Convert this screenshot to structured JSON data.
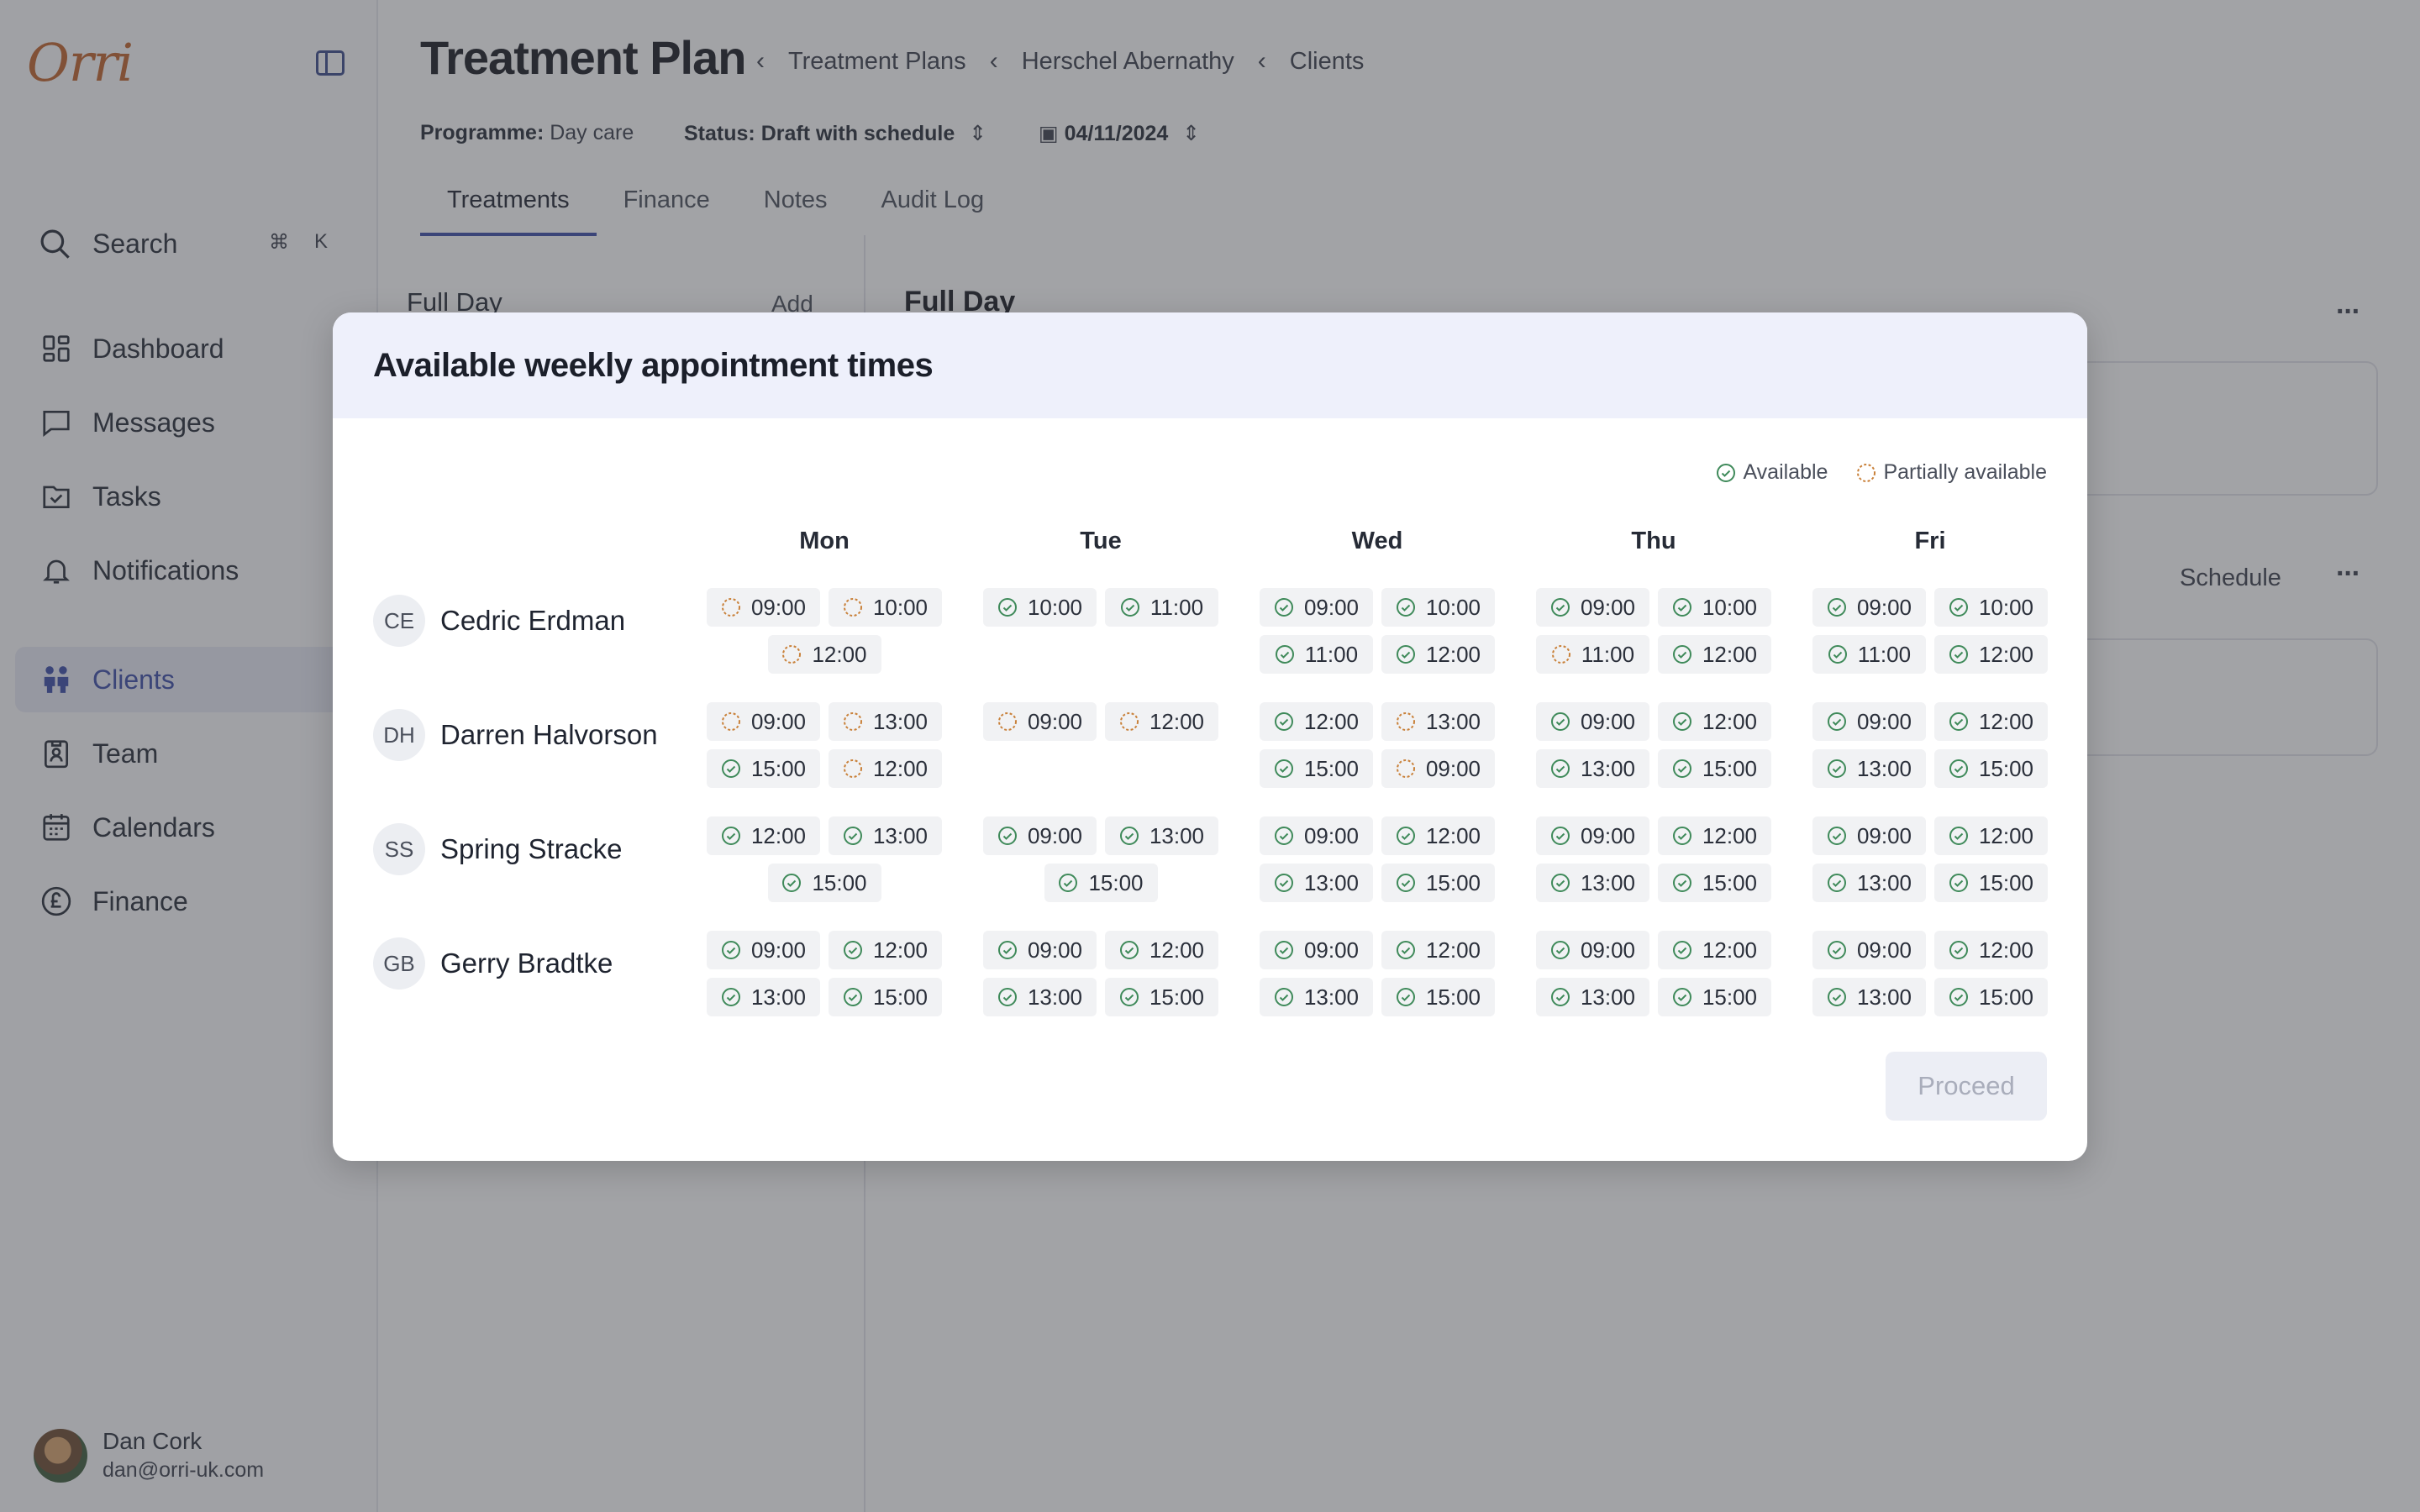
{
  "brand": {
    "logo_text": "Orri",
    "logo_color": "#c0622b",
    "accent": "#3a4ba8"
  },
  "sidebar": {
    "search_label": "Search",
    "search_shortcut_mod": "⌘",
    "search_shortcut_key": "K",
    "items": [
      {
        "label": "Dashboard",
        "icon": "dashboard-icon"
      },
      {
        "label": "Messages",
        "icon": "message-icon"
      },
      {
        "label": "Tasks",
        "icon": "tasks-icon"
      },
      {
        "label": "Notifications",
        "icon": "bell-icon"
      },
      {
        "label": "Clients",
        "icon": "clients-icon",
        "active": true
      },
      {
        "label": "Team",
        "icon": "team-icon"
      },
      {
        "label": "Calendars",
        "icon": "calendar-icon"
      },
      {
        "label": "Finance",
        "icon": "pound-icon"
      }
    ],
    "user": {
      "name": "Dan Cork",
      "email": "dan@orri-uk.com"
    }
  },
  "header": {
    "title": "Treatment Plan",
    "breadcrumbs": [
      "Treatment Plans",
      "Herschel Abernathy",
      "Clients"
    ],
    "programme_label": "Programme:",
    "programme_value": "Day care",
    "status_label": "Status:",
    "status_value": "Draft with schedule",
    "date_value": "04/11/2024",
    "tabs": [
      "Treatments",
      "Finance",
      "Notes",
      "Audit Log"
    ]
  },
  "left_pane": {
    "title": "Full Day",
    "add_label": "Add"
  },
  "right_pane": {
    "title": "Full Day",
    "schedule_label": "Schedule",
    "more": "···"
  },
  "modal": {
    "title": "Available weekly appointment times",
    "legend": {
      "available": "Available",
      "partial": "Partially available"
    },
    "available_color": "#3f8a5a",
    "partial_color": "#c9813a",
    "days": [
      "Mon",
      "Tue",
      "Wed",
      "Thu",
      "Fri"
    ],
    "proceed_label": "Proceed",
    "rows": [
      {
        "initials": "CE",
        "name": "Cedric Erdman",
        "days": [
          [
            {
              "t": "09:00",
              "s": "p"
            },
            {
              "t": "10:00",
              "s": "p"
            },
            {
              "t": "12:00",
              "s": "p"
            }
          ],
          [
            {
              "t": "10:00",
              "s": "a"
            },
            {
              "t": "11:00",
              "s": "a"
            }
          ],
          [
            {
              "t": "09:00",
              "s": "a"
            },
            {
              "t": "10:00",
              "s": "a"
            },
            {
              "t": "11:00",
              "s": "a"
            },
            {
              "t": "12:00",
              "s": "a"
            }
          ],
          [
            {
              "t": "09:00",
              "s": "a"
            },
            {
              "t": "10:00",
              "s": "a"
            },
            {
              "t": "11:00",
              "s": "p"
            },
            {
              "t": "12:00",
              "s": "a"
            }
          ],
          [
            {
              "t": "09:00",
              "s": "a"
            },
            {
              "t": "10:00",
              "s": "a"
            },
            {
              "t": "11:00",
              "s": "a"
            },
            {
              "t": "12:00",
              "s": "a"
            }
          ]
        ]
      },
      {
        "initials": "DH",
        "name": "Darren Halvorson",
        "days": [
          [
            {
              "t": "09:00",
              "s": "p"
            },
            {
              "t": "13:00",
              "s": "p"
            },
            {
              "t": "15:00",
              "s": "a"
            },
            {
              "t": "12:00",
              "s": "p"
            }
          ],
          [
            {
              "t": "09:00",
              "s": "p"
            },
            {
              "t": "12:00",
              "s": "p"
            }
          ],
          [
            {
              "t": "12:00",
              "s": "a"
            },
            {
              "t": "13:00",
              "s": "p"
            },
            {
              "t": "15:00",
              "s": "a"
            },
            {
              "t": "09:00",
              "s": "p"
            }
          ],
          [
            {
              "t": "09:00",
              "s": "a"
            },
            {
              "t": "12:00",
              "s": "a"
            },
            {
              "t": "13:00",
              "s": "a"
            },
            {
              "t": "15:00",
              "s": "a"
            }
          ],
          [
            {
              "t": "09:00",
              "s": "a"
            },
            {
              "t": "12:00",
              "s": "a"
            },
            {
              "t": "13:00",
              "s": "a"
            },
            {
              "t": "15:00",
              "s": "a"
            }
          ]
        ]
      },
      {
        "initials": "SS",
        "name": "Spring Stracke",
        "days": [
          [
            {
              "t": "12:00",
              "s": "a"
            },
            {
              "t": "13:00",
              "s": "a"
            },
            {
              "t": "15:00",
              "s": "a"
            }
          ],
          [
            {
              "t": "09:00",
              "s": "a"
            },
            {
              "t": "13:00",
              "s": "a"
            },
            {
              "t": "15:00",
              "s": "a"
            }
          ],
          [
            {
              "t": "09:00",
              "s": "a"
            },
            {
              "t": "12:00",
              "s": "a"
            },
            {
              "t": "13:00",
              "s": "a"
            },
            {
              "t": "15:00",
              "s": "a"
            }
          ],
          [
            {
              "t": "09:00",
              "s": "a"
            },
            {
              "t": "12:00",
              "s": "a"
            },
            {
              "t": "13:00",
              "s": "a"
            },
            {
              "t": "15:00",
              "s": "a"
            }
          ],
          [
            {
              "t": "09:00",
              "s": "a"
            },
            {
              "t": "12:00",
              "s": "a"
            },
            {
              "t": "13:00",
              "s": "a"
            },
            {
              "t": "15:00",
              "s": "a"
            }
          ]
        ]
      },
      {
        "initials": "GB",
        "name": "Gerry Bradtke",
        "days": [
          [
            {
              "t": "09:00",
              "s": "a"
            },
            {
              "t": "12:00",
              "s": "a"
            },
            {
              "t": "13:00",
              "s": "a"
            },
            {
              "t": "15:00",
              "s": "a"
            }
          ],
          [
            {
              "t": "09:00",
              "s": "a"
            },
            {
              "t": "12:00",
              "s": "a"
            },
            {
              "t": "13:00",
              "s": "a"
            },
            {
              "t": "15:00",
              "s": "a"
            }
          ],
          [
            {
              "t": "09:00",
              "s": "a"
            },
            {
              "t": "12:00",
              "s": "a"
            },
            {
              "t": "13:00",
              "s": "a"
            },
            {
              "t": "15:00",
              "s": "a"
            }
          ],
          [
            {
              "t": "09:00",
              "s": "a"
            },
            {
              "t": "12:00",
              "s": "a"
            },
            {
              "t": "13:00",
              "s": "a"
            },
            {
              "t": "15:00",
              "s": "a"
            }
          ],
          [
            {
              "t": "09:00",
              "s": "a"
            },
            {
              "t": "12:00",
              "s": "a"
            },
            {
              "t": "13:00",
              "s": "a"
            },
            {
              "t": "15:00",
              "s": "a"
            }
          ]
        ]
      }
    ]
  }
}
